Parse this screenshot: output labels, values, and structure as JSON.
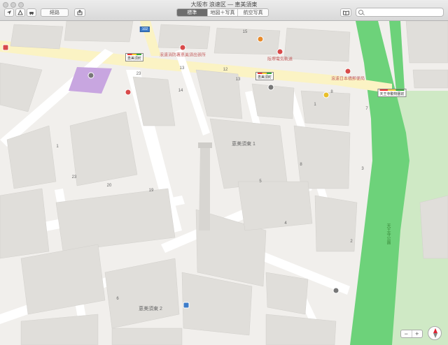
{
  "window": {
    "title": "大阪市 浪速区 — 恵美須東"
  },
  "toolbar": {
    "directions_label": "経路",
    "seg_standard": "標準",
    "seg_hybrid": "地図＋写真",
    "seg_satellite": "航空写真",
    "search_placeholder": ""
  },
  "map": {
    "road_badge": "102",
    "areas": {
      "ebisuhigashi1": "恵美須東 1",
      "ebisuhigashi2": "恵美須東 2"
    },
    "stations": {
      "ebisucho_a": "恵美須町",
      "ebisucho_b": "恵美須町",
      "tennoji_zoo": "天王寺動物園前"
    },
    "pois": {
      "gas": "",
      "red1": "浪速消防署恵美須出張所",
      "red2": "阪堺電気軌道",
      "red3": "浪速日本橋郵便局",
      "yellow": "",
      "atm": "",
      "red_left": "",
      "tower": "",
      "bottom_building": "",
      "blue_left": ""
    },
    "park_label": "天王寺公園",
    "numbers": [
      "23",
      "13",
      "14",
      "12",
      "13",
      "15",
      "20",
      "23",
      "1",
      "19",
      "1",
      "8",
      "3",
      "2",
      "4",
      "5",
      "6",
      "7",
      "11",
      "12",
      "10",
      "18",
      "8",
      "7"
    ]
  }
}
